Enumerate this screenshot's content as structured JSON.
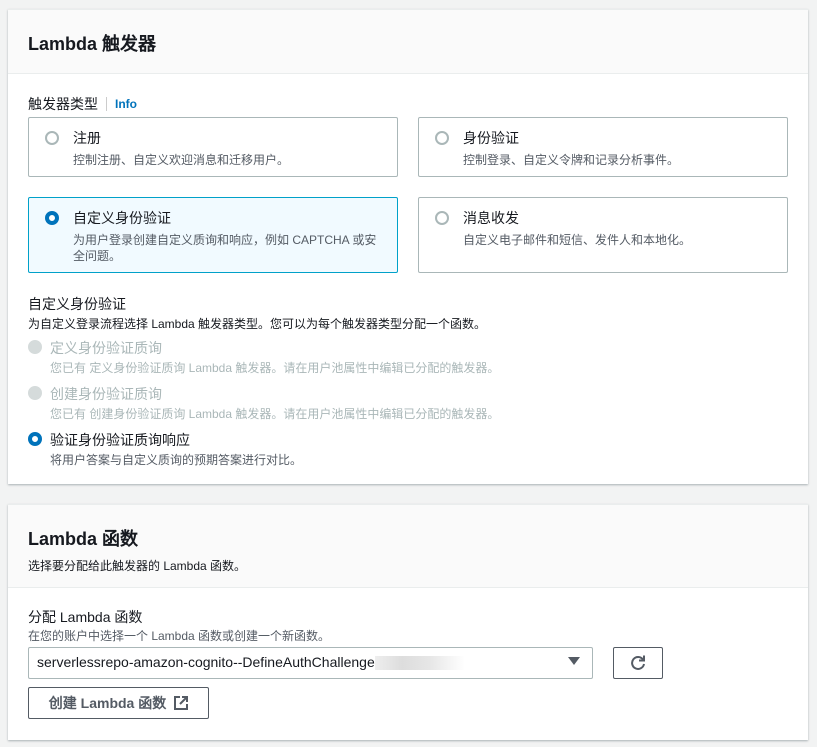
{
  "triggers_panel": {
    "title": "Lambda 触发器",
    "trigger_type_label": "触发器类型",
    "info_link": "Info",
    "tiles": [
      {
        "title": "注册",
        "desc": "控制注册、自定义欢迎消息和迁移用户。",
        "selected": false
      },
      {
        "title": "身份验证",
        "desc": "控制登录、自定义令牌和记录分析事件。",
        "selected": false
      },
      {
        "title": "自定义身份验证",
        "desc": "为用户登录创建自定义质询和响应，例如 CAPTCHA 或安全问题。",
        "selected": true
      },
      {
        "title": "消息收发",
        "desc": "自定义电子邮件和短信、发件人和本地化。",
        "selected": false
      }
    ],
    "custom_auth": {
      "title": "自定义身份验证",
      "desc": "为自定义登录流程选择 Lambda 触发器类型。您可以为每个触发器类型分配一个函数。",
      "options": [
        {
          "title": "定义身份验证质询",
          "desc": "您已有 定义身份验证质询 Lambda 触发器。请在用户池属性中编辑已分配的触发器。",
          "state": "disabled"
        },
        {
          "title": "创建身份验证质询",
          "desc": "您已有 创建身份验证质询 Lambda 触发器。请在用户池属性中编辑已分配的触发器。",
          "state": "disabled"
        },
        {
          "title": "验证身份验证质询响应",
          "desc": "将用户答案与自定义质询的预期答案进行对比。",
          "state": "selected"
        }
      ]
    }
  },
  "function_panel": {
    "title": "Lambda 函数",
    "desc": "选择要分配给此触发器的 Lambda 函数。",
    "assign_label": "分配 Lambda 函数",
    "assign_desc": "在您的账户中选择一个 Lambda 函数或创建一个新函数。",
    "selected_function": "serverlessrepo-amazon-cognito--DefineAuthChallenge",
    "create_button": "创建 Lambda 函数"
  }
}
